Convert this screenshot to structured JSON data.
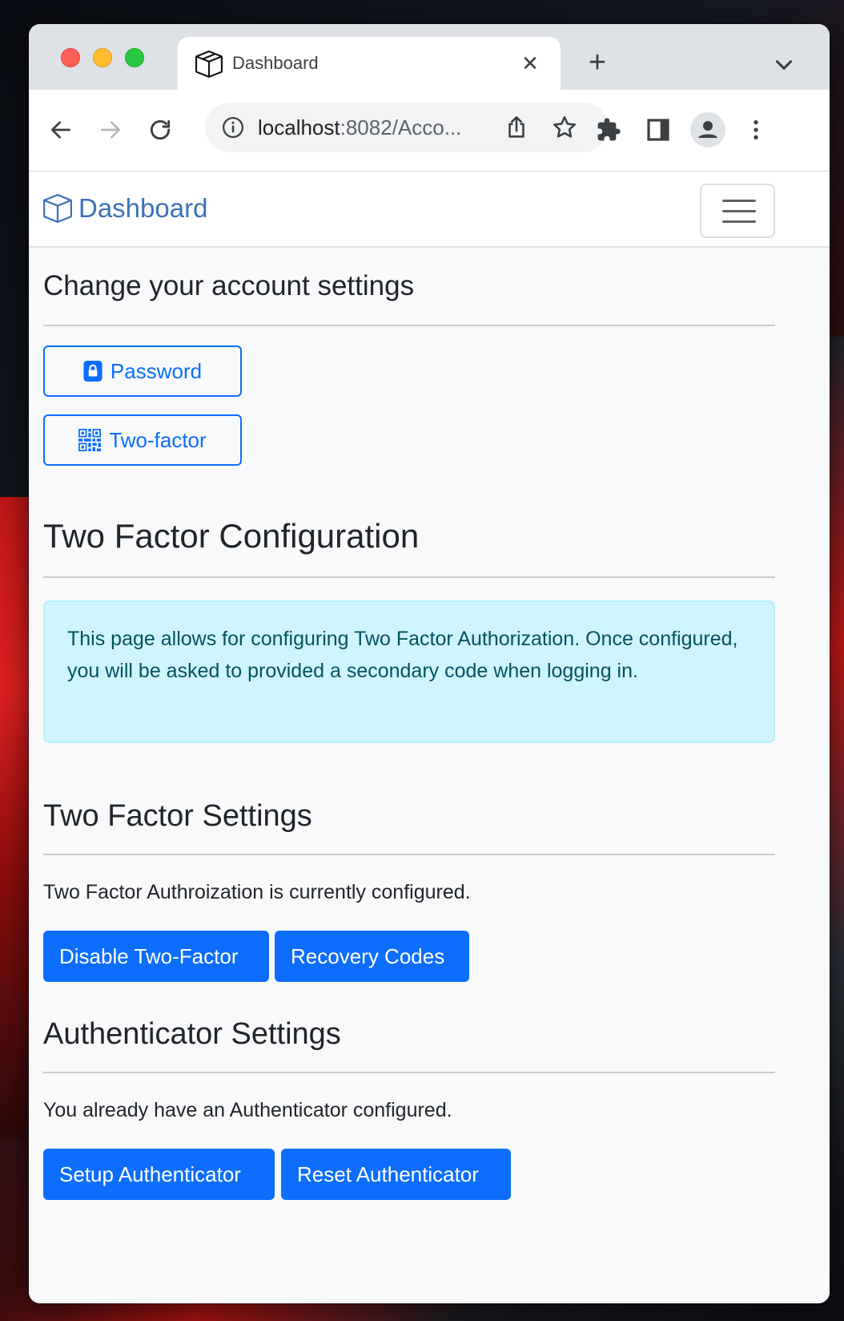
{
  "browser": {
    "tab_title": "Dashboard",
    "url_host": "localhost",
    "url_rest": ":8082/Acco..."
  },
  "navbar": {
    "brand": "Dashboard"
  },
  "account": {
    "heading": "Change your account settings",
    "password_label": "Password",
    "two_factor_label": "Two-factor"
  },
  "two_factor_config": {
    "heading": "Two Factor Configuration",
    "alert_text": "This page allows for configuring Two Factor Authorization. Once configured, you will be asked to provided a secondary code when logging in."
  },
  "two_factor_settings": {
    "heading": "Two Factor Settings",
    "status_text": "Two Factor Authroization is currently configured.",
    "disable_label": "Disable Two-Factor",
    "recovery_label": "Recovery Codes"
  },
  "authenticator_settings": {
    "heading": "Authenticator Settings",
    "status_text": "You already have an Authenticator configured.",
    "setup_label": "Setup Authenticator",
    "reset_label": "Reset Authenticator"
  },
  "colors": {
    "primary": "#0d6efd",
    "brand": "#3d72b8",
    "alert_bg": "#cff4fc",
    "alert_text": "#055160"
  },
  "icons": [
    "box-icon",
    "close-icon",
    "plus-icon",
    "chevron-down-icon",
    "back-arrow-icon",
    "forward-arrow-icon",
    "reload-icon",
    "info-icon",
    "share-icon",
    "star-icon",
    "extensions-icon",
    "sidepanel-icon",
    "profile-icon",
    "more-vert-icon",
    "lock-icon",
    "qr-code-icon",
    "hamburger-icon"
  ]
}
